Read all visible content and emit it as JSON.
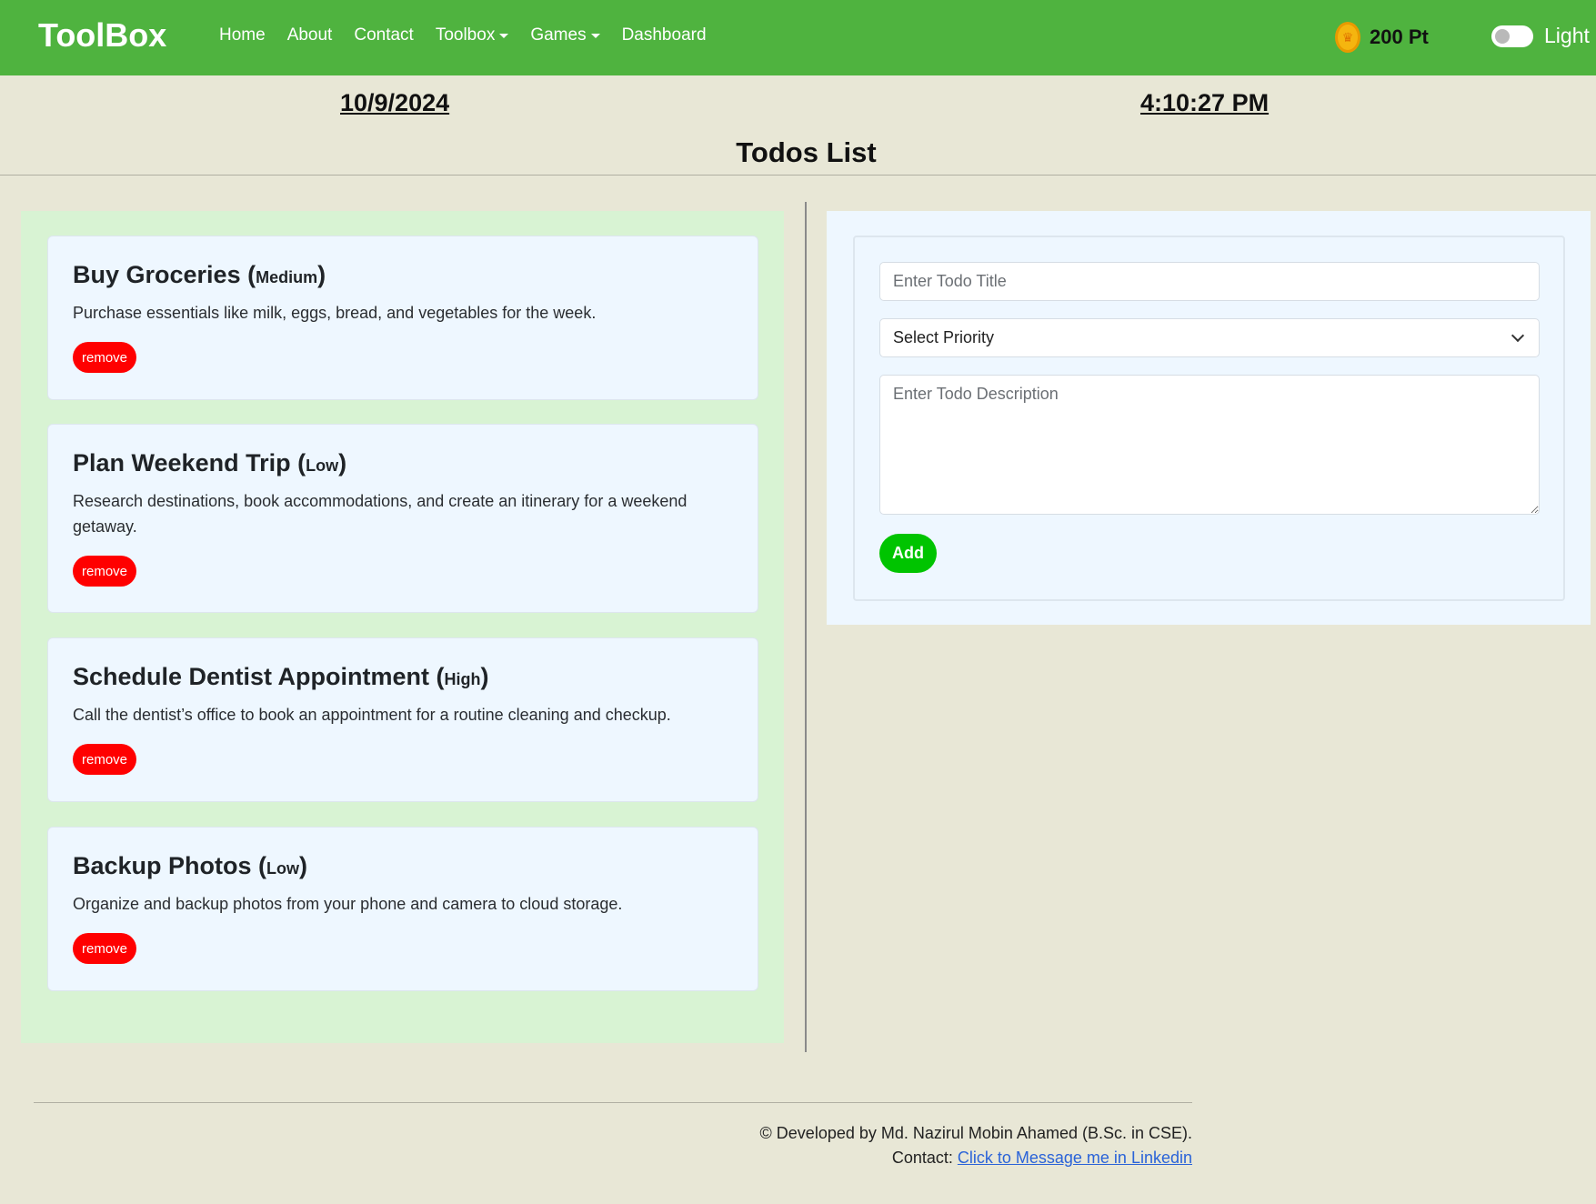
{
  "navbar": {
    "brand": "ToolBox",
    "links": [
      "Home",
      "About",
      "Contact",
      "Toolbox",
      "Games",
      "Dashboard"
    ],
    "points": "200 Pt",
    "theme_label": "Light",
    "color": "#4fb33f"
  },
  "header": {
    "date": "10/9/2024",
    "time": "4:10:27 PM",
    "title": "Todos List"
  },
  "todos": [
    {
      "title": "Buy Groceries",
      "priority": "Medium",
      "description": "Purchase essentials like milk, eggs, bread, and vegetables for the week.",
      "remove_label": "remove"
    },
    {
      "title": "Plan Weekend Trip",
      "priority": "Low",
      "description": "Research destinations, book accommodations, and create an itinerary for a weekend getaway.",
      "remove_label": "remove"
    },
    {
      "title": "Schedule Dentist Appointment",
      "priority": "High",
      "description": "Call the dentist’s office to book an appointment for a routine cleaning and checkup.",
      "remove_label": "remove"
    },
    {
      "title": "Backup Photos",
      "priority": "Low",
      "description": "Organize and backup photos from your phone and camera to cloud storage.",
      "remove_label": "remove"
    }
  ],
  "form": {
    "title_placeholder": "Enter Todo Title",
    "priority_selected": "Select Priority",
    "description_placeholder": "Enter Todo Description",
    "add_label": "Add"
  },
  "footer": {
    "credit": "© Developed by Md. Nazirul Mobin Ahamed (B.Sc. in CSE).",
    "contact_prefix": "Contact: ",
    "contact_link": "Click to Message me in Linkedin"
  },
  "icons": {
    "coin": "coin-icon",
    "caret": "caret-down-icon",
    "chevron": "chevron-down-icon"
  }
}
